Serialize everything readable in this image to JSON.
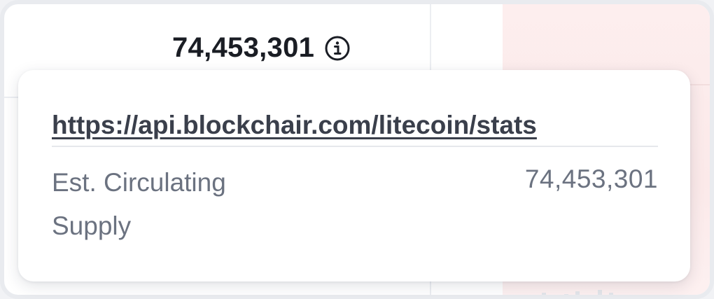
{
  "cell": {
    "value": "74,453,301",
    "info_icon": "info-circle-icon"
  },
  "tooltip": {
    "source_url": "https://api.blockchair.com/litecoin/stats",
    "metric_label": "Est. Circulating Supply",
    "metric_value": "74,453,301"
  },
  "colors": {
    "value_text": "#1a1d24",
    "muted_text": "#6b7280",
    "link_text": "#3a3f4b",
    "highlight_cell": "#fdeeee"
  }
}
